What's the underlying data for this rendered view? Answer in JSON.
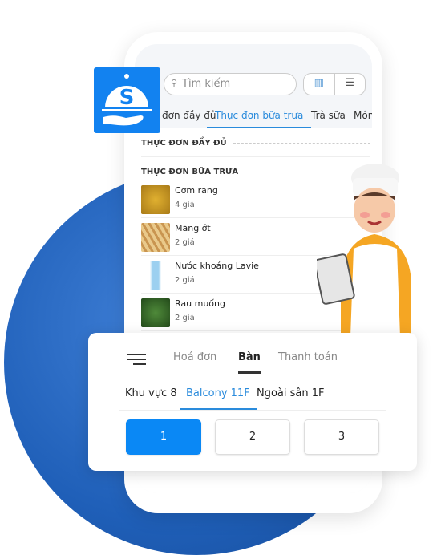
{
  "search": {
    "placeholder": "Tìm kiếm",
    "icon": "search-icon"
  },
  "view_buttons": [
    {
      "icon": "book-icon"
    },
    {
      "icon": "list-icon"
    }
  ],
  "menu_tabs": [
    {
      "label": "đơn đầy đủ"
    },
    {
      "label": "Thực đơn bữa trưa",
      "active": true
    },
    {
      "label": "Trà sữa"
    },
    {
      "label": "Món"
    }
  ],
  "sections": [
    {
      "title": "THỰC ĐƠN ĐẦY ĐỦ"
    },
    {
      "title": "THỰC ĐƠN BỮA TRƯA"
    }
  ],
  "items": [
    {
      "name": "Cơm rang",
      "price": "4 giá"
    },
    {
      "name": "Măng ớt",
      "price": "2 giá"
    },
    {
      "name": "Nước khoáng Lavie",
      "price": "2 giá"
    },
    {
      "name": "Rau muống",
      "price": "2 giá"
    }
  ],
  "logo": {
    "letter": "S"
  },
  "card": {
    "tabs": [
      {
        "label": "Hoá đơn"
      },
      {
        "label": "Bàn",
        "active": true
      },
      {
        "label": "Thanh toán"
      }
    ],
    "zones": [
      {
        "label": "Khu vực 8"
      },
      {
        "label": "Balcony 11F",
        "active": true
      },
      {
        "label": "Ngoài sân 1F"
      }
    ],
    "tables": [
      {
        "label": "1",
        "selected": true
      },
      {
        "label": "2"
      },
      {
        "label": "3"
      }
    ]
  },
  "colors": {
    "accent": "#2a8bdc",
    "selected": "#0a88f5",
    "logo": "#1282f0"
  }
}
